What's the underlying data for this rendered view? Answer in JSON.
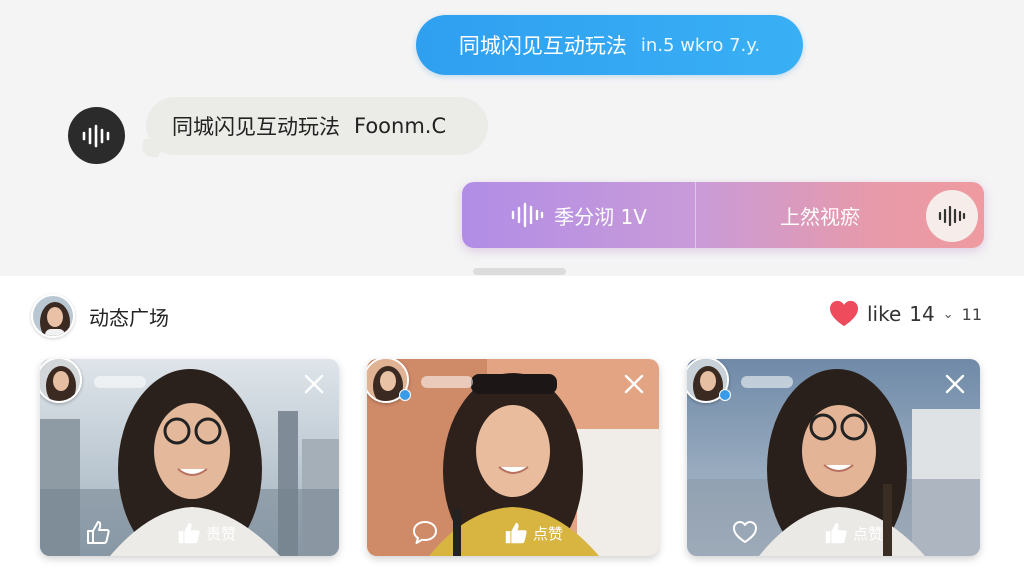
{
  "chat": {
    "bubble_right": {
      "text": "同城闪见互动玩法",
      "trail": "in.5 wkro 7.y."
    },
    "bubble_left": {
      "text": "同城闪见互动玩法",
      "trail": "Foonm.C"
    },
    "voice_bar": {
      "left_text": "季分沏 1V",
      "mid_text": "上然视瘀"
    }
  },
  "feed": {
    "title": "动态广场",
    "like_label": "like",
    "like_count": "14",
    "secondary_count": "11",
    "cards": [
      {
        "like_text": "责赞",
        "comment_icon": "thumbs-up-outline-icon"
      },
      {
        "like_text": "点赞",
        "comment_icon": "comment-icon"
      },
      {
        "like_text": "点赞",
        "comment_icon": "heart-comment-icon"
      }
    ]
  },
  "colors": {
    "bubble_blue": "#2f9ff0",
    "voice_gradient_start": "#b18de6",
    "voice_gradient_end": "#ee9aa0",
    "heart": "#ee4b5c"
  }
}
